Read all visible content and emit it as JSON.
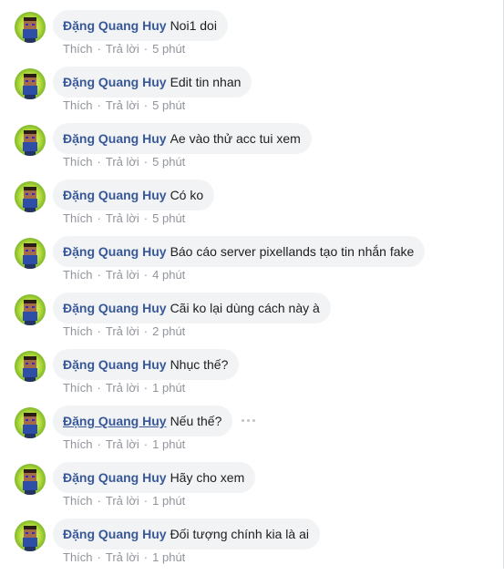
{
  "labels": {
    "like": "Thích",
    "reply": "Trả lời",
    "separator": "·"
  },
  "colors": {
    "author": "#385898",
    "bubble": "#f2f3f5",
    "meta": "#90949c"
  },
  "comments": [
    {
      "author": "Đặng Quang Huy",
      "text": "Noi1 doi",
      "time": "5 phút"
    },
    {
      "author": "Đặng Quang Huy",
      "text": "Edit tin nhan",
      "time": "5 phút"
    },
    {
      "author": "Đặng Quang Huy",
      "text": "Ae vào thử acc tui xem",
      "time": "5 phút"
    },
    {
      "author": "Đặng Quang Huy",
      "text": "Có ko",
      "time": "5 phút"
    },
    {
      "author": "Đặng Quang Huy",
      "text": "Báo cáo server pixellands tạo tin nhắn fake",
      "time": "4 phút"
    },
    {
      "author": "Đặng Quang Huy",
      "text": "Cãi ko lại dùng cách này à",
      "time": "2 phút"
    },
    {
      "author": "Đặng Quang Huy",
      "text": "Nhục thế?",
      "time": "1 phút"
    },
    {
      "author": "Đặng Quang Huy",
      "text": "Nếu thế?",
      "time": "1 phút",
      "hovered": true,
      "more_icon": "more-options-icon"
    },
    {
      "author": "Đặng Quang Huy",
      "text": "Hãy cho xem",
      "time": "1 phút"
    },
    {
      "author": "Đặng Quang Huy",
      "text": "Đối tượng chính kia là ai",
      "time": "1 phút"
    }
  ]
}
